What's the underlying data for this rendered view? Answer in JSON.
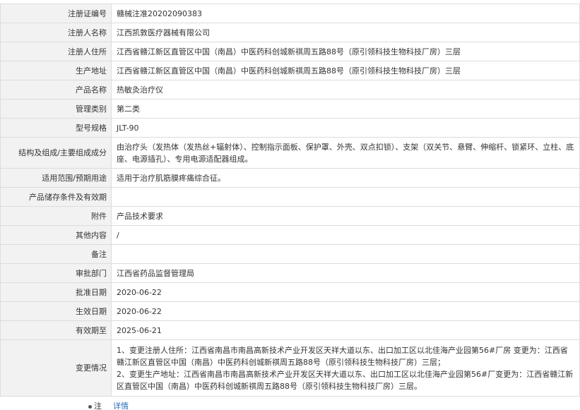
{
  "rows": [
    {
      "label": "注册证编号",
      "value": "赣械注准20202090383"
    },
    {
      "label": "注册人名称",
      "value": "江西凯敦医疗器械有限公司"
    },
    {
      "label": "注册人住所",
      "value": "江西省赣江新区直管区中国（南昌）中医药科创城新祺周五路88号（原引领科技生物科技厂房）三层"
    },
    {
      "label": "生产地址",
      "value": "江西省赣江新区直管区中国（南昌）中医药科创城新祺周五路88号（原引领科技生物科技厂房）三层"
    },
    {
      "label": "产品名称",
      "value": "热敏灸治疗仪"
    },
    {
      "label": "管理类别",
      "value": "第二类"
    },
    {
      "label": "型号规格",
      "value": "JLT-90"
    },
    {
      "label": "结构及组成/主要组成成分",
      "value": "由治疗头（发热体（发热丝+辐射体）、控制指示面板、保护罩、外壳、双点扣锁）、支架（双关节、悬臂、伸缩杆、锁紧环、立柱、底座、电源插孔）、专用电源适配器组成。"
    },
    {
      "label": "适用范围/预期用途",
      "value": "适用于治疗肌筋膜疼痛综合征。"
    },
    {
      "label": "产品储存条件及有效期",
      "value": ""
    },
    {
      "label": "附件",
      "value": "产品技术要求"
    },
    {
      "label": "其他内容",
      "value": "/"
    },
    {
      "label": "备注",
      "value": ""
    },
    {
      "label": "审批部门",
      "value": "江西省药品监督管理局"
    },
    {
      "label": "批准日期",
      "value": "2020-06-22"
    },
    {
      "label": "生效日期",
      "value": "2020-06-22"
    },
    {
      "label": "有效期至",
      "value": "2025-06-21"
    }
  ],
  "changes": {
    "label": "变更情况",
    "line1": "1、变更注册人住所：江西省南昌市南昌高新技术产业开发区天祥大道以东、出口加工区以北佳海产业园第56#厂房 变更为：江西省赣江新区直管区中国（南昌）中医药科创城新祺周五路88号（原引领科技生物科技厂房）三层；",
    "line2": "2、变更生产地址：江西省南昌市南昌高新技术产业开发区天祥大道以东、出口加工区以北佳海产业园第56#厂变更为：江西省赣江新区直管区中国（南昌）中医药科创城新祺周五路88号（原引领科技生物科技厂房）三层。"
  },
  "note": {
    "label": "注",
    "link": "详情"
  }
}
